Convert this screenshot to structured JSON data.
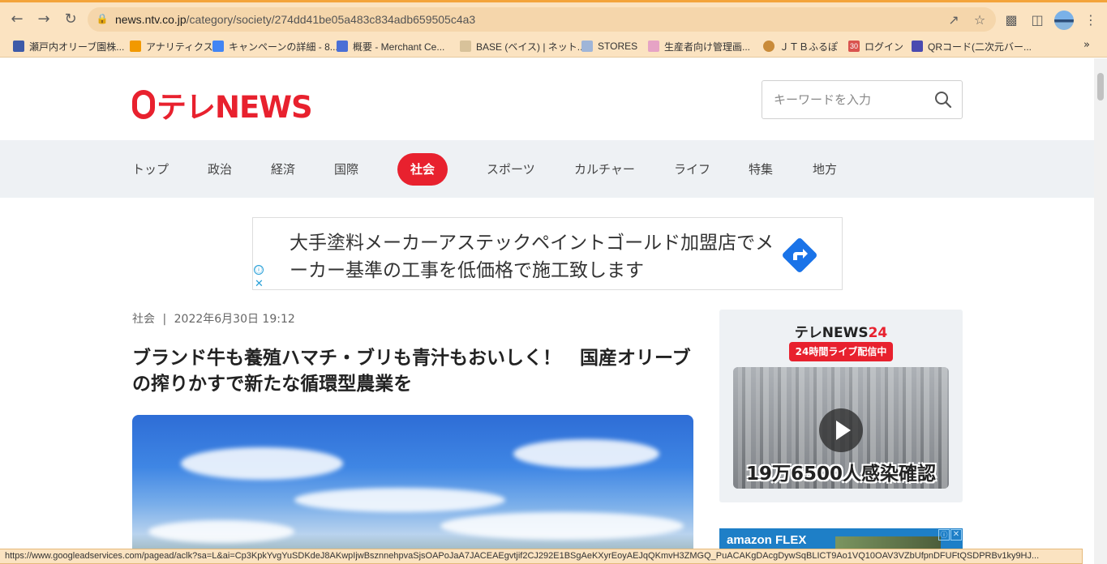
{
  "browser": {
    "url_domain": "news.ntv.co.jp",
    "url_path": "/category/society/274dd41be05a483c834adb659505c4a3",
    "status_url": "https://www.googleadservices.com/pagead/aclk?sa=L&ai=Cp3KpkYvgYuSDKdeJ8AKwpIjwBsznnehpvaSjsOAPoJaA7JACEAEgvtjif2CJ292E1BSgAeKXyrEoyAEJqQKmvH3ZMGQ_PuACAKgDAcgDywSqBLICT9Ao1VQ10OAV3VZbUfpnDFUFtQSDPRBv1ky9HJ...",
    "icons": {
      "back": "arrow-left-icon",
      "forward": "arrow-right-icon",
      "reload": "reload-icon",
      "lock": "lock-icon",
      "share": "share-icon",
      "star": "star-icon",
      "extensions": "puzzle-icon",
      "sidepanel": "side-panel-icon",
      "menu": "kebab-menu-icon"
    }
  },
  "bookmarks": [
    {
      "label": "瀬戸内オリーブ園株...",
      "color": "#3d5aa8"
    },
    {
      "label": "アナリティクス",
      "color": "#f29900"
    },
    {
      "label": "キャンペーンの詳細 - 8...",
      "color": "#4285f4"
    },
    {
      "label": "概要 - Merchant Ce...",
      "color": "#4a6fd6"
    },
    {
      "label": "BASE (ベイス) | ネット...",
      "color": "#d8c29a"
    },
    {
      "label": "STORES",
      "color": "#9fb5d8"
    },
    {
      "label": "生産者向け管理画...",
      "color": "#e6a3c5"
    },
    {
      "label": "ＪＴＢふるぽ",
      "color": "#c98b3a"
    },
    {
      "label": "ログイン",
      "color": "#d9534f",
      "badge": "30"
    },
    {
      "label": "QRコード(二次元バー...",
      "color": "#4a4ab0"
    }
  ],
  "bookmarks_more": "»",
  "site": {
    "logo_text": "テレNEWS",
    "search_placeholder": "キーワードを入力",
    "nav": [
      "トップ",
      "政治",
      "経済",
      "国際",
      "社会",
      "スポーツ",
      "カルチャー",
      "ライフ",
      "特集",
      "地方"
    ],
    "active_nav": "社会",
    "brand_color": "#e8212e"
  },
  "ad": {
    "text": "大手塗料メーカーアステックペイントゴールド加盟店でメーカー基準の工事を低価格で施工致します",
    "info_icon": "ⓘ",
    "close_icon": "✕"
  },
  "article": {
    "category": "社会",
    "separator": "|",
    "date": "2022年6月30日 19:12",
    "title": "ブランド牛も養殖ハマチ・ブリも青汁もおいしく！　国産オリーブの搾りかすで新たな循環型農業を"
  },
  "sidebar": {
    "logo_main": "テレNEWS",
    "logo_num": "24",
    "live_badge": "24時間ライブ配信中",
    "caption": "19万6500人感染確認"
  },
  "amazon_ad": {
    "text": "amazon FLEX",
    "info_icon": "ⓘ",
    "close_icon": "✕"
  }
}
